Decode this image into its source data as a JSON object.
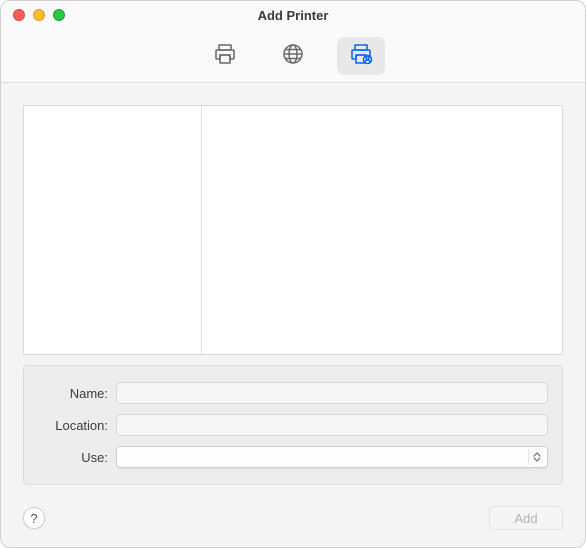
{
  "window": {
    "title": "Add Printer"
  },
  "tabs": {
    "default_label": "Default",
    "ip_label": "IP",
    "windows_label": "Windows",
    "selected": "windows"
  },
  "form": {
    "name_label": "Name:",
    "name_value": "",
    "location_label": "Location:",
    "location_value": "",
    "use_label": "Use:",
    "use_value": ""
  },
  "footer": {
    "help_label": "?",
    "add_label": "Add",
    "add_enabled": false
  },
  "colors": {
    "accent": "#0a66ff",
    "icon_inactive": "#6b6b6b"
  }
}
